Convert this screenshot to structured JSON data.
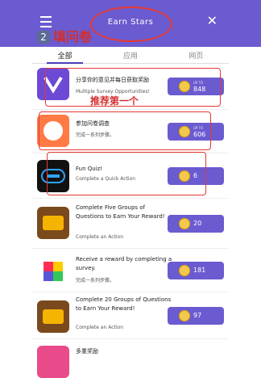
{
  "header": {
    "title": "Earn Stars",
    "close_icon": "close-icon",
    "menu_icon": "hamburger-icon"
  },
  "tabs": [
    {
      "label": "全部",
      "active": true
    },
    {
      "label": "应用",
      "active": false
    },
    {
      "label": "网页",
      "active": false
    }
  ],
  "items": [
    {
      "title": "分享你的意见并每日获取奖励",
      "subtitle": "Multiple Survey Opportunities!",
      "reward_prefix": "UP TO",
      "reward": "848"
    },
    {
      "title": "参加问卷调查",
      "subtitle": "完成一系列步骤。",
      "reward_prefix": "UP TO",
      "reward": "606"
    },
    {
      "title": "Fun Quiz!",
      "subtitle": "Complete a Quick Action",
      "reward_prefix": "",
      "reward": "6"
    },
    {
      "title": "Complete Five Groups of Questions to Earn Your Reward!",
      "subtitle": "Complete an Action",
      "reward_prefix": "",
      "reward": "20"
    },
    {
      "title": "Receive a reward by completing a survey.",
      "subtitle": "完成一系列步骤。",
      "reward_prefix": "",
      "reward": "181"
    },
    {
      "title": "Complete 20 Groups of Questions to Earn Your Reward!",
      "subtitle": "Complete an Action",
      "reward_prefix": "",
      "reward": "97"
    },
    {
      "title": "多重奖励",
      "subtitle": "",
      "reward_prefix": "",
      "reward": ""
    }
  ],
  "annotations": {
    "badge": "2",
    "label_top": "填问卷",
    "label_mid": "推荐第一个"
  },
  "colors": {
    "accent": "#6b5bd0",
    "annotation": "#e53935"
  }
}
